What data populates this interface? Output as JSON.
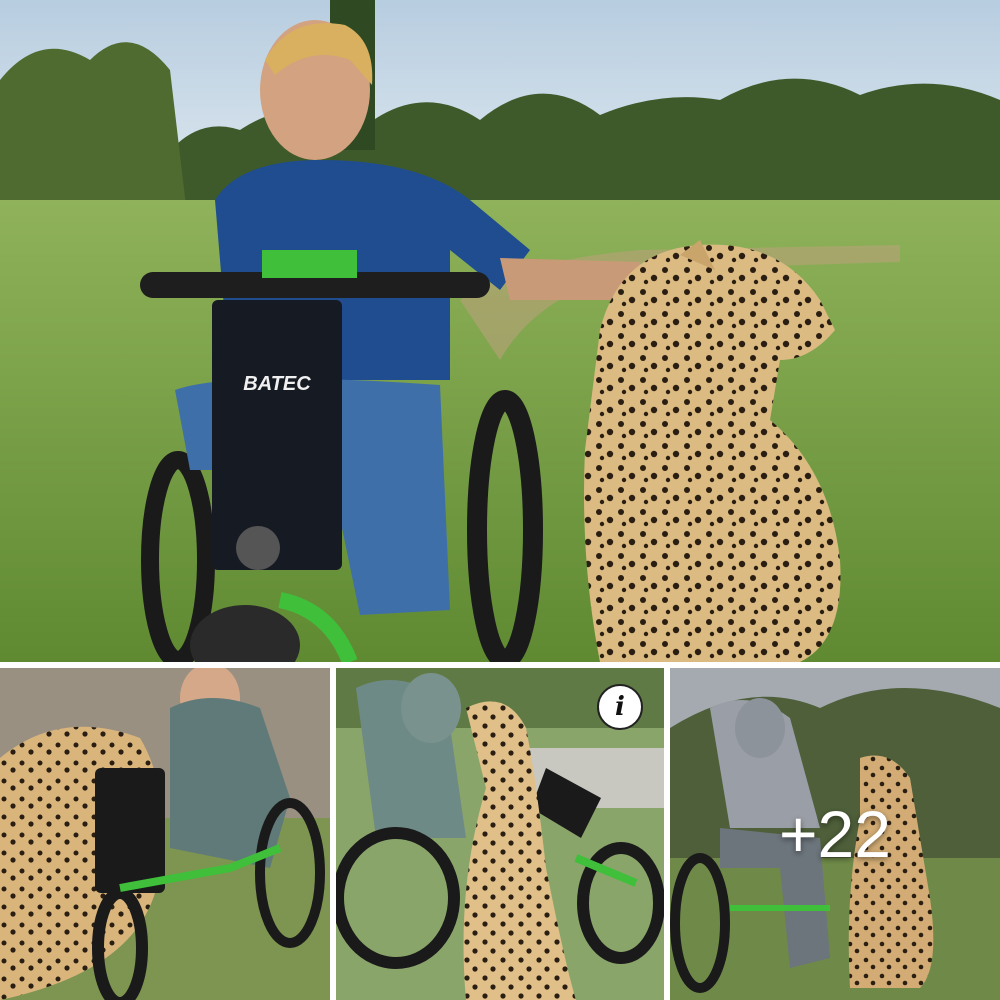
{
  "gallery": {
    "info_icon_glyph": "i",
    "more_count": "+22",
    "main_photo": {
      "brand_text": "BATEC"
    }
  },
  "colors": {
    "sky": "#c9dbe8",
    "grass": "#7fa14a",
    "shirt": "#1f4d8f",
    "cheetah": "#d8b57a",
    "wheelchair_accent": "#3fbf3a"
  }
}
